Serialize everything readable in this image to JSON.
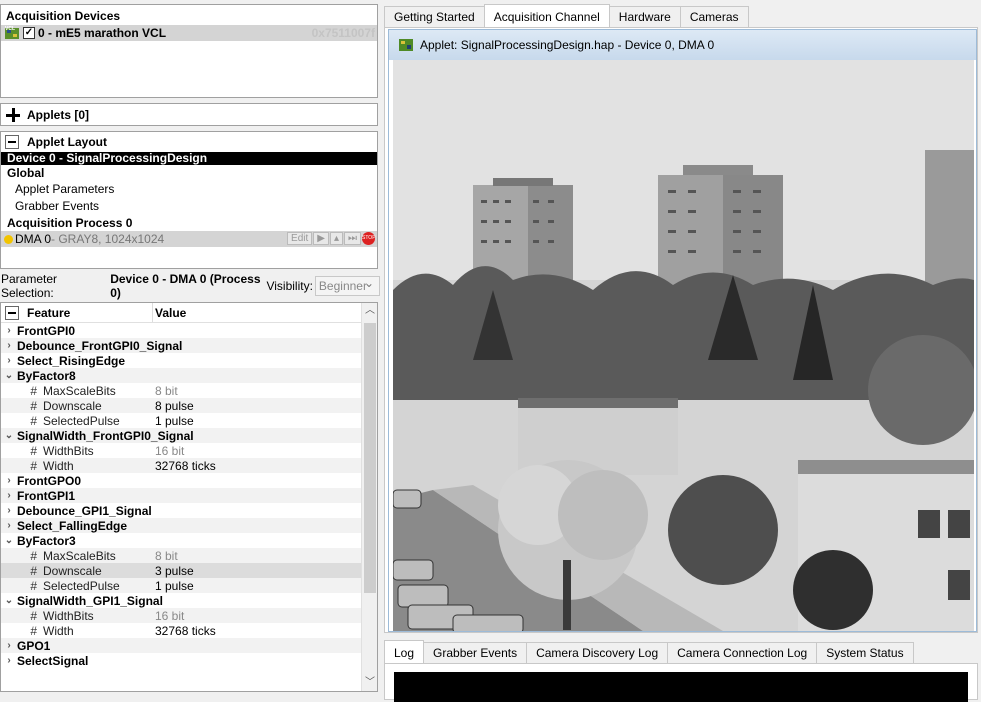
{
  "devices": {
    "title": "Acquisition Devices",
    "item": "0 - mE5 marathon VCL",
    "item_id": "0x7511007f",
    "checked": true
  },
  "applets": {
    "label": "Applets [0]"
  },
  "layout": {
    "title": "Applet Layout",
    "device": "Device 0 - SignalProcessingDesign",
    "global": "Global",
    "items": [
      "Applet Parameters",
      "Grabber Events"
    ],
    "process": "Acquisition Process 0",
    "dma_name": "DMA 0",
    "dma_info": " - GRAY8, 1024x1024",
    "edit": "Edit"
  },
  "param_selection": {
    "label": "Parameter Selection:",
    "value": "Device 0 - DMA 0 (Process 0)",
    "visibility_label": "Visibility:",
    "visibility_value": "Beginner"
  },
  "tree": {
    "col_feature": "Feature",
    "col_value": "Value",
    "rows": [
      {
        "kind": "cat",
        "name": "FrontGPI0",
        "state": "collapsed"
      },
      {
        "kind": "cat",
        "name": "Debounce_FrontGPI0_Signal",
        "state": "collapsed"
      },
      {
        "kind": "cat",
        "name": "Select_RisingEdge",
        "state": "collapsed"
      },
      {
        "kind": "cat",
        "name": "ByFactor8",
        "state": "expanded"
      },
      {
        "kind": "leaf",
        "name": "MaxScaleBits",
        "value": "8 bit",
        "readonly": true
      },
      {
        "kind": "leaf",
        "name": "Downscale",
        "value": "8 pulse"
      },
      {
        "kind": "leaf",
        "name": "SelectedPulse",
        "value": "1 pulse"
      },
      {
        "kind": "cat",
        "name": "SignalWidth_FrontGPI0_Signal",
        "state": "expanded"
      },
      {
        "kind": "leaf",
        "name": "WidthBits",
        "value": "16 bit",
        "readonly": true
      },
      {
        "kind": "leaf",
        "name": "Width",
        "value": "32768 ticks"
      },
      {
        "kind": "cat",
        "name": "FrontGPO0",
        "state": "collapsed"
      },
      {
        "kind": "cat",
        "name": "FrontGPI1",
        "state": "collapsed"
      },
      {
        "kind": "cat",
        "name": "Debounce_GPI1_Signal",
        "state": "collapsed"
      },
      {
        "kind": "cat",
        "name": "Select_FallingEdge",
        "state": "collapsed"
      },
      {
        "kind": "cat",
        "name": "ByFactor3",
        "state": "expanded"
      },
      {
        "kind": "leaf",
        "name": "MaxScaleBits",
        "value": "8 bit",
        "readonly": true
      },
      {
        "kind": "leaf",
        "name": "Downscale",
        "value": "3 pulse",
        "selected": true
      },
      {
        "kind": "leaf",
        "name": "SelectedPulse",
        "value": "1 pulse"
      },
      {
        "kind": "cat",
        "name": "SignalWidth_GPI1_Signal",
        "state": "expanded"
      },
      {
        "kind": "leaf",
        "name": "WidthBits",
        "value": "16 bit",
        "readonly": true
      },
      {
        "kind": "leaf",
        "name": "Width",
        "value": "32768 ticks"
      },
      {
        "kind": "cat",
        "name": "GPO1",
        "state": "collapsed"
      },
      {
        "kind": "cat",
        "name": "SelectSignal",
        "state": "collapsed"
      }
    ]
  },
  "top_tabs": [
    {
      "label": "Getting Started"
    },
    {
      "label": "Acquisition Channel",
      "active": true
    },
    {
      "label": "Hardware"
    },
    {
      "label": "Cameras"
    }
  ],
  "applet_window": {
    "title": "Applet: SignalProcessingDesign.hap - Device 0, DMA 0"
  },
  "bottom_tabs": [
    {
      "label": "Log",
      "active": true
    },
    {
      "label": "Grabber Events"
    },
    {
      "label": "Camera Discovery Log"
    },
    {
      "label": "Camera Connection Log"
    },
    {
      "label": "System Status"
    }
  ]
}
